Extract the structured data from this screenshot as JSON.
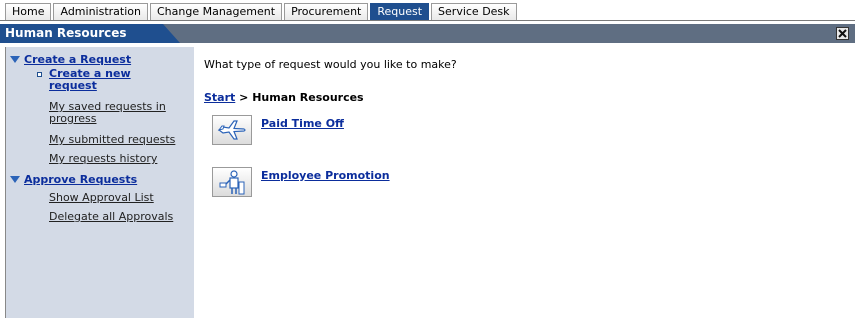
{
  "tabs": [
    {
      "label": "Home",
      "active": false
    },
    {
      "label": "Administration",
      "active": false
    },
    {
      "label": "Change Management",
      "active": false
    },
    {
      "label": "Procurement",
      "active": false
    },
    {
      "label": "Request",
      "active": true
    },
    {
      "label": "Service Desk",
      "active": false
    }
  ],
  "header": {
    "title": "Human Resources",
    "close_icon": "close-icon"
  },
  "sidebar": {
    "create_group": {
      "label": "Create a Request",
      "current_item": "Create a new request",
      "items": [
        "My saved requests in progress",
        "My submitted requests",
        "My requests history"
      ]
    },
    "approve_group": {
      "label": "Approve Requests",
      "items": [
        "Show Approval List",
        "Delegate all Approvals"
      ]
    }
  },
  "main": {
    "prompt": "What type of request would you like to make?",
    "breadcrumb": {
      "start": "Start",
      "separator": ">",
      "current": "Human Resources"
    },
    "requests": [
      {
        "label": "Paid Time Off",
        "icon": "airplane-icon"
      },
      {
        "label": "Employee Promotion",
        "icon": "person-podium-icon"
      }
    ]
  },
  "colors": {
    "accent": "#1f4f8f",
    "header_band": "#5f6e82",
    "sidebar_bg": "#d3dae6",
    "link": "#0b2d9c"
  }
}
